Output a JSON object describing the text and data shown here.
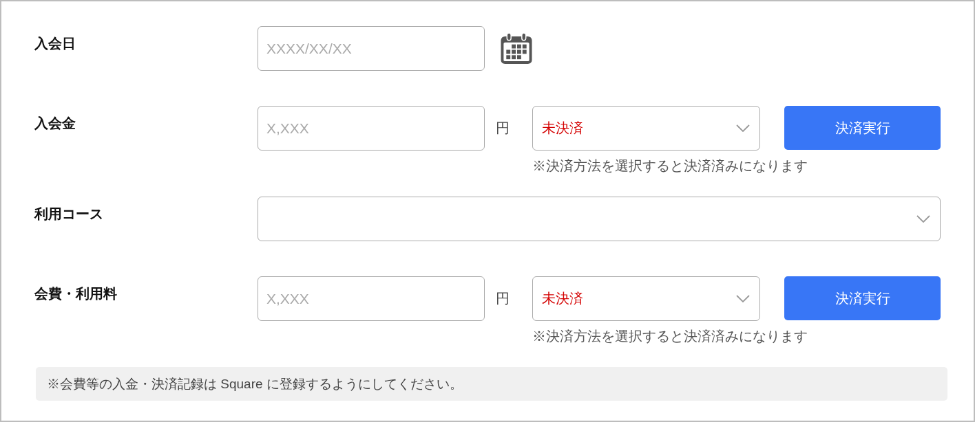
{
  "fields": [
    {
      "kind": "date",
      "label": "入会日",
      "placeholder": "XXXX/XX/XX"
    },
    {
      "kind": "payment",
      "label": "入会金",
      "placeholder": "X,XXX",
      "unit": "円",
      "status": "未決済",
      "button": "決済実行",
      "note": "※決済方法を選択すると決済済みになります"
    },
    {
      "kind": "select",
      "label": "利用コース"
    },
    {
      "kind": "payment",
      "label": "会費・利用料",
      "placeholder": "X,XXX",
      "unit": "円",
      "status": "未決済",
      "button": "決済実行",
      "note": "※決済方法を選択すると決済済みになります"
    }
  ],
  "notice": "※会費等の入金・決済記録は Square に登録するようにしてください。"
}
